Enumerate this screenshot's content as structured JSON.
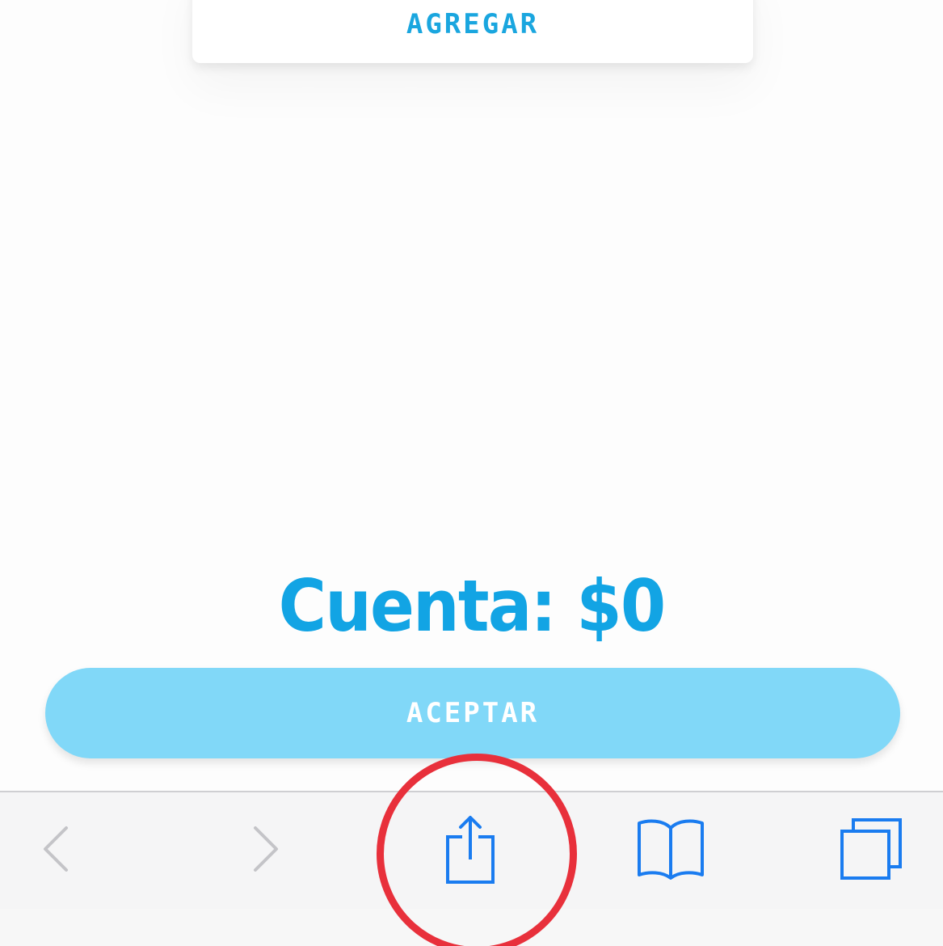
{
  "card": {
    "add_label": "AGREGAR"
  },
  "summary": {
    "total_text": "Cuenta: $0"
  },
  "actions": {
    "accept_label": "ACEPTAR"
  },
  "toolbar": {
    "items": [
      {
        "name": "back",
        "icon": "chevron-left-icon",
        "enabled": false
      },
      {
        "name": "forward",
        "icon": "chevron-right-icon",
        "enabled": false
      },
      {
        "name": "share",
        "icon": "share-icon",
        "enabled": true
      },
      {
        "name": "bookmarks",
        "icon": "book-icon",
        "enabled": true
      },
      {
        "name": "tabs",
        "icon": "tabs-icon",
        "enabled": true
      }
    ]
  },
  "colors": {
    "accent": "#12a4e4",
    "accept_button": "#81d8f8",
    "toolbar_icon": "#1a7cf0",
    "toolbar_icon_disabled": "#c4c4c8",
    "highlight_ring": "#e8303b"
  }
}
